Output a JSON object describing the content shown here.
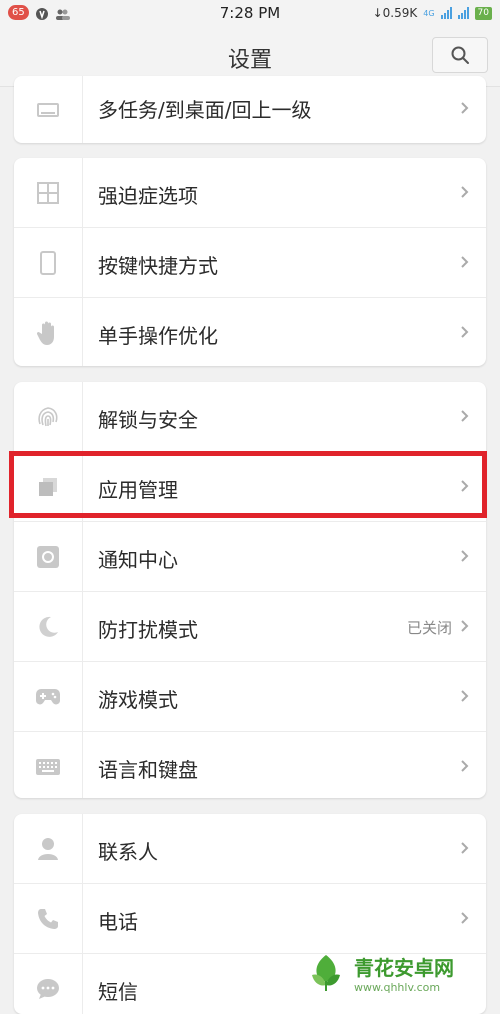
{
  "status": {
    "notification_count": "65",
    "time": "7:28 PM",
    "net_speed": "↓0.59K",
    "network_type": "4G",
    "battery": "70"
  },
  "header": {
    "title": "设置"
  },
  "groups": [
    {
      "items": [
        {
          "label": "多任务/到桌面/回上一级",
          "icon": "multitask-icon"
        }
      ]
    },
    {
      "items": [
        {
          "label": "强迫症选项",
          "icon": "grid-icon"
        },
        {
          "label": "按键快捷方式",
          "icon": "phone-outline-icon"
        },
        {
          "label": "单手操作优化",
          "icon": "hand-icon"
        }
      ]
    },
    {
      "items": [
        {
          "label": "解锁与安全",
          "icon": "fingerprint-icon"
        },
        {
          "label": "应用管理",
          "icon": "app-manage-icon"
        },
        {
          "label": "通知中心",
          "icon": "notification-icon"
        },
        {
          "label": "防打扰模式",
          "icon": "moon-icon",
          "value": "已关闭"
        },
        {
          "label": "游戏模式",
          "icon": "gamepad-icon"
        },
        {
          "label": "语言和键盘",
          "icon": "keyboard-icon"
        }
      ]
    },
    {
      "items": [
        {
          "label": "联系人",
          "icon": "contact-icon"
        },
        {
          "label": "电话",
          "icon": "phone-icon"
        },
        {
          "label": "短信",
          "icon": "message-icon"
        }
      ]
    }
  ],
  "watermark": {
    "title": "青花安卓网",
    "url": "www.qhhlv.com"
  },
  "colors": {
    "highlight": "#e0232b",
    "icon_gray": "#c8c8c8"
  }
}
